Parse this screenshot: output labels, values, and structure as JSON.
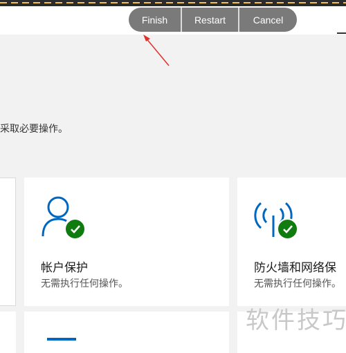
{
  "toolbar": {
    "finish_label": "Finish",
    "restart_label": "Restart",
    "cancel_label": "Cancel"
  },
  "page": {
    "intro_text": "采取必要操作。"
  },
  "cards": {
    "account": {
      "title": "帐户保护",
      "status": "无需执行任何操作。"
    },
    "firewall": {
      "title": "防火墙和网络保",
      "status": "无需执行任何操作。"
    }
  },
  "watermark": {
    "text": "软件技巧"
  },
  "colors": {
    "accent_blue": "#0067c0",
    "status_green": "#107c10",
    "arrow_red": "#e0302c",
    "pill_gray": "#7a7a7a"
  },
  "icons": [
    "person-icon",
    "wifi-antenna-icon",
    "check-icon",
    "minimize-icon"
  ]
}
